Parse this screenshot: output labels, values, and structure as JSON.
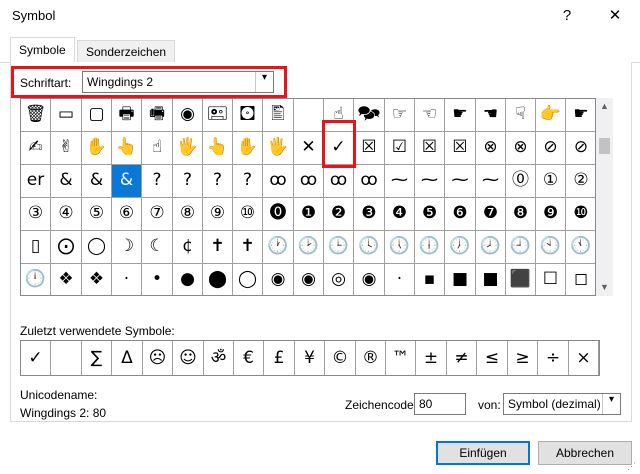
{
  "window": {
    "title": "Symbol",
    "help": "?",
    "close": "✕"
  },
  "tabs": [
    {
      "label": "Symbole",
      "active": true
    },
    {
      "label": "Sonderzeichen",
      "active": false
    }
  ],
  "font": {
    "label": "Schriftart:",
    "value": "Wingdings 2",
    "arrow": "▾"
  },
  "highlight_color": "#e8141b",
  "selection_color": "#0a78d7",
  "symbol_grid": {
    "selected_index": 41,
    "rows": [
      [
        "🗑",
        "▭",
        "▢",
        "🖶",
        "🖷",
        "◉",
        "🖭",
        "🖸",
        "🖺",
        "",
        "☝",
        "🗫",
        "☞",
        "☜",
        "☛",
        "☚",
        "☟",
        "👉",
        "☛"
      ],
      [
        "✍",
        "✌",
        "✋",
        "👆",
        "☝",
        "🖐",
        "👆",
        "✋",
        "🖐",
        "✕",
        "✓",
        "☒",
        "☑",
        "☒",
        "☒",
        "⊗",
        "⊗",
        "⊘",
        "⊘"
      ],
      [
        "er",
        "&",
        "&",
        "&",
        "?",
        "?",
        "?",
        "?",
        "ꝏ",
        "ꝏ",
        "ꝏ",
        "ꝏ",
        "⁓",
        "⁓",
        "⁓",
        "⁓",
        "⓪",
        "①",
        "②"
      ],
      [
        "③",
        "④",
        "⑤",
        "⑥",
        "⑦",
        "⑧",
        "⑨",
        "⑩",
        "⓿",
        "❶",
        "❷",
        "❸",
        "❹",
        "❺",
        "❻",
        "❼",
        "❽",
        "❾",
        "❿"
      ],
      [
        "▯",
        "⨀",
        "◯",
        "☽",
        "☾",
        "¢",
        "✝",
        "✝",
        "🕐",
        "🕑",
        "🕒",
        "🕓",
        "🕔",
        "🕕",
        "🕖",
        "🕗",
        "🕘",
        "🕙",
        "🕚"
      ],
      [
        "🕛",
        "❖",
        "❖",
        "·",
        "•",
        "●",
        "⬤",
        "◯",
        "◉",
        "◉",
        "◎",
        "◉",
        "·",
        "▪",
        "■",
        "■",
        "⬛",
        "☐",
        "◻"
      ]
    ]
  },
  "recent": {
    "label": "Zuletzt verwendete Symbole:",
    "symbols": [
      "✓",
      "",
      "∑",
      "Δ",
      "☹",
      "☺",
      "ॐ",
      "€",
      "£",
      "¥",
      "©",
      "®",
      "™",
      "±",
      "≠",
      "≤",
      "≥",
      "÷",
      "×"
    ]
  },
  "unicode_name": {
    "label": "Unicodename:",
    "value": "Wingdings 2: 80"
  },
  "char_code": {
    "label": "Zeichencode:",
    "value": "80"
  },
  "from": {
    "label": "von:",
    "value": "Symbol (dezimal)"
  },
  "buttons": {
    "insert": "Einfügen",
    "cancel": "Abbrechen"
  },
  "scrollbar": {
    "up": "▲",
    "down": "▼"
  }
}
